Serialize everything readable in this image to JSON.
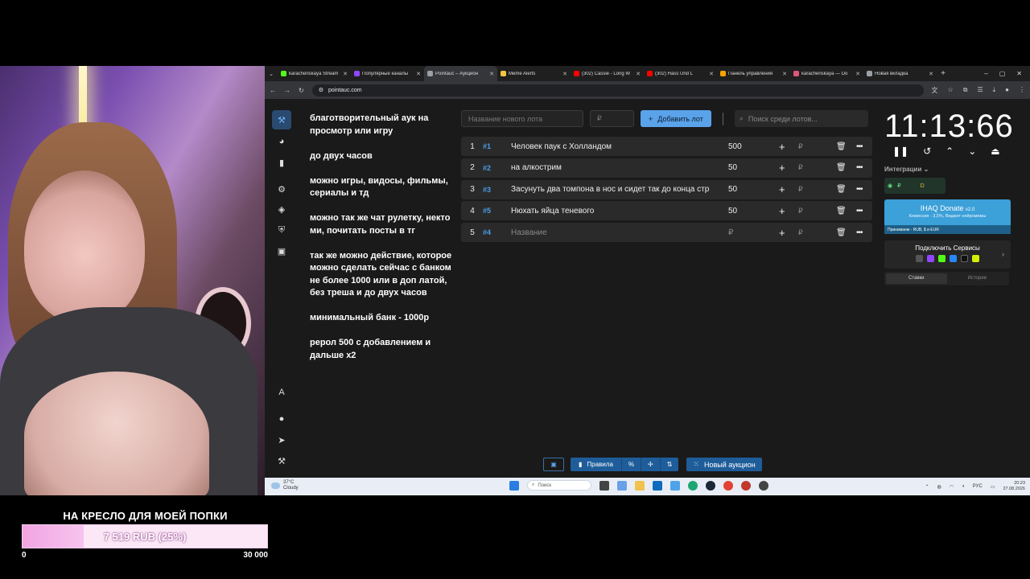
{
  "overlay": {
    "goal_title": "НА КРЕСЛО ДЛЯ МОЕЙ ПОПКИ",
    "goal_text": "7 519 RUB (25%)",
    "goal_progress": 0.25,
    "goal_min": "0",
    "goal_max": "30 000"
  },
  "browser": {
    "tabs": [
      {
        "title": "karachenskaya Stream",
        "color": "#53fc18"
      },
      {
        "title": "Популярные каналы",
        "color": "#9146ff"
      },
      {
        "title": "Pointauc – Аукцион",
        "color": "#9aa0a6",
        "active": true
      },
      {
        "title": "Meme Alerts",
        "color": "#f5c542"
      },
      {
        "title": "(302) Cassie - Long W",
        "color": "#ff0000"
      },
      {
        "title": "(302) Hass Und L",
        "color": "#ff0000"
      },
      {
        "title": "Панель управления",
        "color": "#f7a400"
      },
      {
        "title": "karachenskaya — Do",
        "color": "#e0567a"
      },
      {
        "title": "Новая вкладка",
        "color": "#9aa0a6"
      }
    ],
    "url": "pointauc.com"
  },
  "notes": [
    "благотворительный аук на просмотр или игру",
    "до  двух часов",
    "можно игры, видосы, фильмы, сериалы и тд",
    "можно так же чат рулетку, некто ми, почитать посты в тг",
    "так же можно действие, которое можно сделать сейчас с банком не более 1000 или в доп латой, без треша  и до двух часов",
    "минимальный банк - 1000р",
    "рерол 500 с добавлением и дальше х2"
  ],
  "toolbar": {
    "lot_name_placeholder": "Название нового лота",
    "amount_placeholder": "₽",
    "add_label": "Добавить лот",
    "search_placeholder": "Поиск среди лотов..."
  },
  "lots": [
    {
      "num": "1",
      "hash": "#1",
      "name": "Человек паук с Холландом",
      "amount": "500"
    },
    {
      "num": "2",
      "hash": "#2",
      "name": "на алкострим",
      "amount": "50"
    },
    {
      "num": "3",
      "hash": "#3",
      "name": "Засунуть два томпона в нос и сидет так до конца стр",
      "amount": "50"
    },
    {
      "num": "4",
      "hash": "#5",
      "name": "Нюхать яйца теневого",
      "amount": "50"
    },
    {
      "num": "5",
      "hash": "#4",
      "name": "Название",
      "amount": "₽",
      "placeholder": true
    }
  ],
  "timer": "11:13:66",
  "integrations": {
    "label": "Интеграции",
    "donate_title": "IHAQ Donate",
    "donate_version": "v2.0",
    "donate_sub": "Комиссия - 3,5%, Виджет нейромемы",
    "donate_footer": "Принимаем - RUB, $ и EUR",
    "services_title": "Подключить Сервисы",
    "tab_bets": "Ставки",
    "tab_history": "Истории"
  },
  "bottom": {
    "rules": "Правила",
    "new_auction": "Новый аукцион"
  },
  "taskbar": {
    "temp": "37°C",
    "weather": "Cloudy",
    "search": "Поиск",
    "lang": "РУС",
    "time": "20:23",
    "date": "27.08.2026"
  }
}
